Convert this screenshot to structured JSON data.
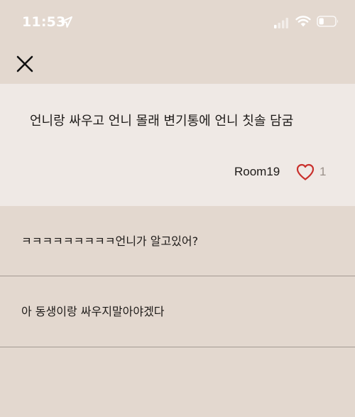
{
  "status_bar": {
    "time": "11:53",
    "location_icon": "location-arrow-icon",
    "cellular_icon": "cellular-signal-icon",
    "wifi_icon": "wifi-icon",
    "battery_icon": "battery-icon",
    "battery_level": 0.3
  },
  "nav": {
    "close_icon": "close-icon"
  },
  "post": {
    "title": "언니랑 싸우고 언니 몰래 변기통에 언니 칫솔 담굼",
    "author": "Room19",
    "like_icon": "heart-outline-icon",
    "like_count": "1",
    "accent_color": "#c9302c"
  },
  "comments": [
    {
      "text": "ㅋㅋㅋㅋㅋㅋㅋㅋㅋ언니가 알고있어?"
    },
    {
      "text": "아 동생이랑 싸우지말아야겠다"
    }
  ],
  "colors": {
    "background": "#e3d8cf",
    "post_background": "#efe9e5",
    "divider": "#a49a93"
  }
}
